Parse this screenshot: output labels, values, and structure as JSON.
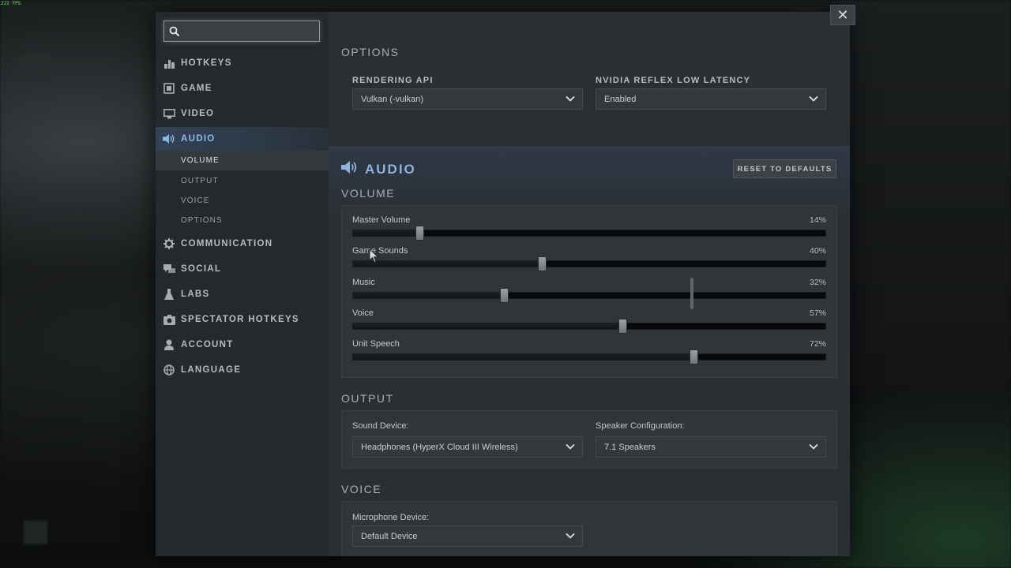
{
  "fps_overlay": "222 FPS",
  "search": {
    "value": "",
    "placeholder": ""
  },
  "sidebar": {
    "items": [
      {
        "label": "HOTKEYS"
      },
      {
        "label": "GAME"
      },
      {
        "label": "VIDEO"
      },
      {
        "label": "AUDIO"
      },
      {
        "label": "COMMUNICATION"
      },
      {
        "label": "SOCIAL"
      },
      {
        "label": "LABS"
      },
      {
        "label": "SPECTATOR HOTKEYS"
      },
      {
        "label": "ACCOUNT"
      },
      {
        "label": "LANGUAGE"
      }
    ],
    "audio_subitems": [
      {
        "label": "VOLUME"
      },
      {
        "label": "OUTPUT"
      },
      {
        "label": "VOICE"
      },
      {
        "label": "OPTIONS"
      }
    ],
    "active_item": "AUDIO",
    "active_subitem": "VOLUME"
  },
  "video_options": {
    "section_title": "OPTIONS",
    "rendering_api_label": "RENDERING API",
    "rendering_api_value": "Vulkan (-vulkan)",
    "reflex_label": "NVIDIA REFLEX LOW LATENCY",
    "reflex_value": "Enabled"
  },
  "audio": {
    "title": "AUDIO",
    "reset_label": "RESET TO DEFAULTS",
    "volume_title": "VOLUME",
    "sliders": [
      {
        "label": "Master Volume",
        "value_text": "14%",
        "value": 14
      },
      {
        "label": "Game Sounds",
        "value_text": "40%",
        "value": 40
      },
      {
        "label": "Music",
        "value_text": "32%",
        "value": 32
      },
      {
        "label": "Voice",
        "value_text": "57%",
        "value": 57
      },
      {
        "label": "Unit Speech",
        "value_text": "72%",
        "value": 72
      }
    ],
    "output_title": "OUTPUT",
    "sound_device_label": "Sound Device:",
    "sound_device_value": "Headphones (HyperX Cloud III Wireless)",
    "speaker_config_label": "Speaker Configuration:",
    "speaker_config_value": "7.1 Speakers",
    "voice_title": "VOICE",
    "mic_label": "Microphone Device:",
    "mic_value": "Default Device"
  },
  "close_label": "✕",
  "colors": {
    "accent": "#8fb8e8",
    "panel": "#2b2f33",
    "sidebar": "#25292c"
  }
}
